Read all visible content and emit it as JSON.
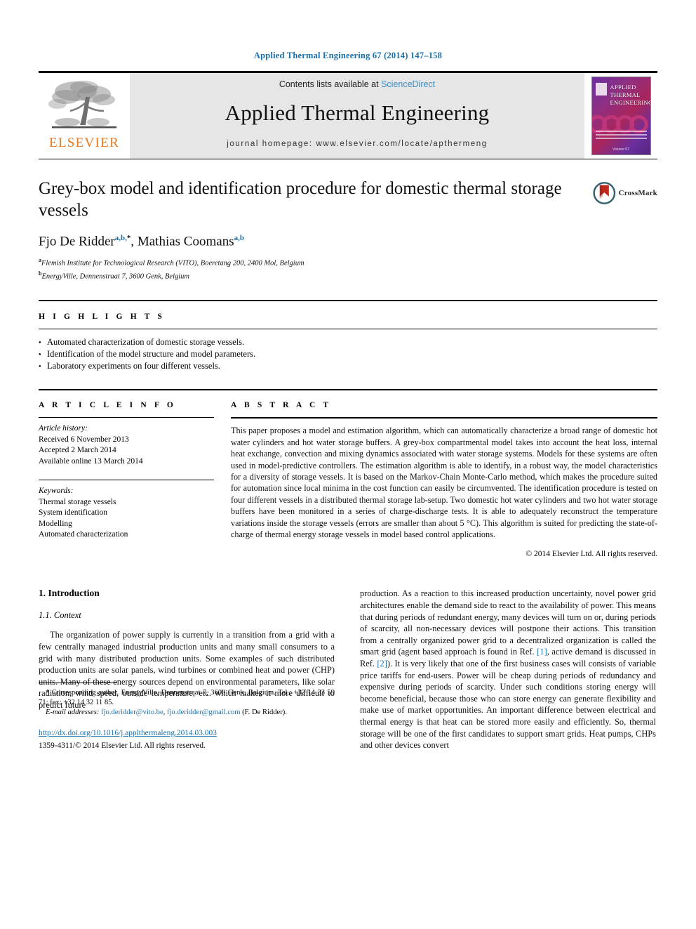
{
  "running_head": "Applied Thermal Engineering 67 (2014) 147–158",
  "masthead": {
    "publisher_logo_text": "ELSEVIER",
    "contents_prefix": "Contents lists available at",
    "contents_link": "ScienceDirect",
    "journal_name": "Applied Thermal Engineering",
    "homepage": "journal homepage: www.elsevier.com/locate/apthermeng",
    "cover": {
      "line1": "APPLIED",
      "line2": "THERMAL",
      "line3": "ENGINEERING",
      "bottom_caption": "Volume 67"
    },
    "colors": {
      "link_blue": "#3a8dc4",
      "elsevier_orange": "#e8761c",
      "panel_grey": "#e6e6e6"
    }
  },
  "article": {
    "title": "Grey-box model and identification procedure for domestic thermal storage vessels",
    "crossmark_label": "CrossMark",
    "authors_html": "Fjo De Ridder, Mathias Coomans",
    "author_list": [
      {
        "name": "Fjo De Ridder",
        "marks": "a,b,*"
      },
      {
        "name": "Mathias Coomans",
        "marks": "a,b"
      }
    ],
    "affiliations": [
      {
        "mark": "a",
        "text": "Flemish Institute for Technological Research (VITO), Boeretang 200, 2400 Mol, Belgium"
      },
      {
        "mark": "b",
        "text": "EnergyVille, Dennenstraat 7, 3600 Genk, Belgium"
      }
    ]
  },
  "highlights": {
    "heading": "H I G H L I G H T S",
    "items": [
      "Automated characterization of domestic storage vessels.",
      "Identification of the model structure and model parameters.",
      "Laboratory experiments on four different vessels."
    ]
  },
  "article_info": {
    "heading": "A R T I C L E   I N F O",
    "history_label": "Article history:",
    "history": [
      "Received 6 November 2013",
      "Accepted 2 March 2014",
      "Available online 13 March 2014"
    ],
    "keywords_label": "Keywords:",
    "keywords": [
      "Thermal storage vessels",
      "System identification",
      "Modelling",
      "Automated characterization"
    ]
  },
  "abstract": {
    "heading": "A B S T R A C T",
    "text": "This paper proposes a model and estimation algorithm, which can automatically characterize a broad range of domestic hot water cylinders and hot water storage buffers. A grey-box compartmental model takes into account the heat loss, internal heat exchange, convection and mixing dynamics associated with water storage systems. Models for these systems are often used in model-predictive controllers. The estimation algorithm is able to identify, in a robust way, the model characteristics for a diversity of storage vessels. It is based on the Markov-Chain Monte-Carlo method, which makes the procedure suited for automation since local minima in the cost function can easily be circumvented. The identification procedure is tested on four different vessels in a distributed thermal storage lab-setup. Two domestic hot water cylinders and two hot water storage buffers have been monitored in a series of charge-discharge tests. It is able to adequately reconstruct the temperature variations inside the storage vessels (errors are smaller than about 5 °C). This algorithm is suited for predicting the state-of-charge of thermal energy storage vessels in model based control applications.",
    "copyright": "© 2014 Elsevier Ltd. All rights reserved."
  },
  "body": {
    "section_number_title": "1. Introduction",
    "subsection_number_title": "1.1. Context",
    "left_paragraph": "The organization of power supply is currently in a transition from a grid with a few centrally managed industrial production units and many small consumers to a grid with many distributed production units. Some examples of such distributed production units are solar panels, wind turbines or combined heat and power (CHP) units. Many of these energy sources depend on environmental parameters, like solar radiation, wind speed, outside temperature, etc. which makes it more difficult to predict future",
    "right_paragraph_part1": "production. As a reaction to this increased production uncertainty, novel power grid architectures enable the demand side to react to the availability of power. This means that during periods of redundant energy, many devices will turn on or, during periods of scarcity, all non-necessary devices will postpone their actions. This transition from a centrally organized power grid to a decentralized organization is called the smart grid (agent based approach is found in Ref. ",
    "ref_1": "[1]",
    "right_paragraph_part2": ", active demand is discussed in Ref. ",
    "ref_2": "[2]",
    "right_paragraph_part3": "). It is very likely that one of the first business cases will consists of variable price tariffs for end-users. Power will be cheap during periods of redundancy and expensive during periods of scarcity. Under such conditions storing energy will become beneficial, because those who can store energy can generate flexibility and make use of market opportunities. An important difference between electrical and thermal energy is that heat can be stored more easily and efficiently. So, thermal storage will be one of the first candidates to support smart grids. Heat pumps, CHPs and other devices convert"
  },
  "footnote": {
    "corresponding": "* Corresponding author. EnergyVille, Dennenstraat 7, 3600 Genk, Belgium. Tel.: +32 14 33 59 71; fax: +32 14 32 11 85.",
    "email_label": "E-mail addresses:",
    "email_1": "fjo.deridder@vito.be",
    "email_sep": ", ",
    "email_2": "fjo.deridder@gmail.com",
    "email_attrib": " (F. De Ridder).",
    "doi": "http://dx.doi.org/10.1016/j.applthermaleng.2014.03.003",
    "issn": "1359-4311/© 2014 Elsevier Ltd. All rights reserved."
  }
}
